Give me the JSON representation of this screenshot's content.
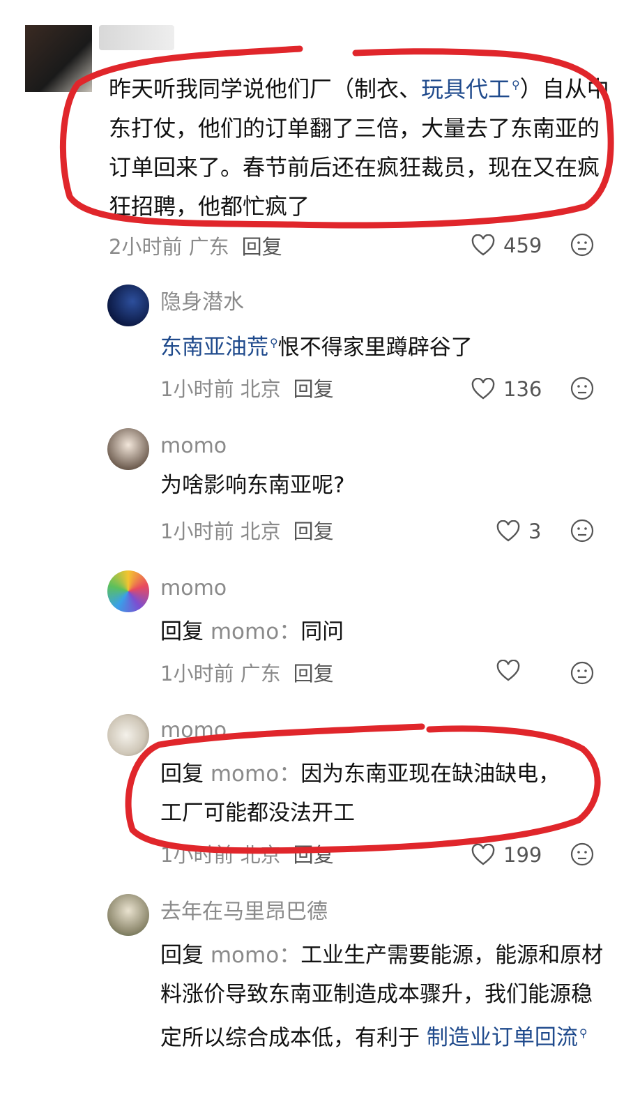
{
  "comment_main": {
    "text_before_link": "昨天听我同学说他们厂（制衣、",
    "link": "玩具代工",
    "text_after_link": "）自从中东打仗，他们的订单翻了三倍，大量去了东南亚的订单回来了。春节前后还在疯狂裁员，现在又在疯狂招聘，他都忙疯了",
    "meta": "2小时前 广东",
    "reply_label": "回复",
    "likes": "459"
  },
  "replies": [
    {
      "name": "隐身潜水",
      "link": "东南亚油荒",
      "text": "恨不得家里蹲辟谷了",
      "meta": "1小时前 北京",
      "reply_label": "回复",
      "likes": "136"
    },
    {
      "name": "momo",
      "text": "为啥影响东南亚呢?",
      "meta": "1小时前 北京",
      "reply_label": "回复",
      "likes": "3"
    },
    {
      "name": "momo",
      "reply_prefix": "回复",
      "reply_to": "momo：",
      "text": "同问",
      "meta": "1小时前 广东",
      "reply_label": "回复",
      "likes": ""
    },
    {
      "name": "momo",
      "reply_prefix": "回复",
      "reply_to": "momo：",
      "text": "因为东南亚现在缺油缺电，工厂可能都没法开工",
      "meta": "1小时前 北京",
      "reply_label": "回复",
      "likes": "199"
    },
    {
      "name": "去年在马里昂巴德",
      "reply_prefix": "回复",
      "reply_to": "momo：",
      "text": "工业生产需要能源，能源和原材料涨价导致东南亚制造成本骤升，我们能源稳定所以综合成本低，有利于",
      "link": "制造业订单回流"
    }
  ],
  "icons": {
    "like": "heart-outline-icon",
    "emoji": "neutral-face-icon",
    "search_hint": "search-icon"
  },
  "colors": {
    "link": "#1f4a8c",
    "meta": "#8a8a8a",
    "annotation": "#e0262b"
  }
}
